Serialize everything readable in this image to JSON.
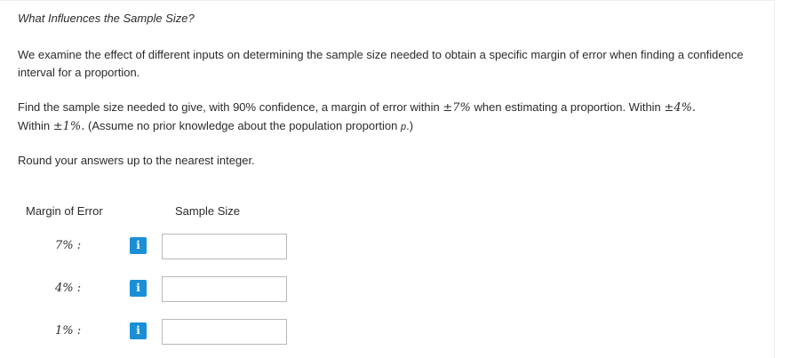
{
  "question": {
    "title": "What Influences the Sample Size?",
    "intro": "We examine the effect of different inputs on determining the sample size needed to obtain a specific margin of error when finding a confidence interval for a proportion.",
    "instruction_part1": "Find the sample size needed to give, with 90% confidence, a margin of error within ",
    "pm_symbol": "±",
    "moe_1": "7%",
    "instruction_part2": " when estimating a proportion. Within ",
    "moe_2": "4%.",
    "instruction_part3": "Within ",
    "moe_3": "1%.",
    "instruction_part4": " (Assume no prior knowledge about the population proportion ",
    "p_symbol": "p",
    "instruction_part5": ".)",
    "rounding_note": "Round your answers up to the nearest integer."
  },
  "table": {
    "header_margin": "Margin of Error",
    "header_sample": "Sample Size",
    "rows": [
      {
        "label": "7% :",
        "info_icon": "i",
        "value": ""
      },
      {
        "label": "4% :",
        "info_icon": "i",
        "value": ""
      },
      {
        "label": "1% :",
        "info_icon": "i",
        "value": ""
      }
    ]
  },
  "colors": {
    "info_button": "#1a8fd6",
    "text": "#2b2b2b",
    "input_border": "#b9b9b9"
  }
}
